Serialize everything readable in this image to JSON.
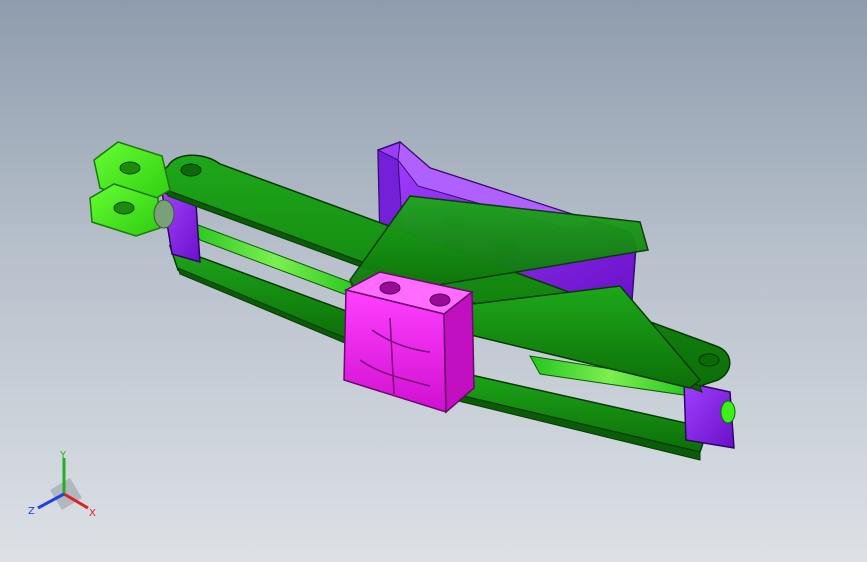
{
  "viewport": {
    "background_top": "#8f9cad",
    "background_bottom": "#dde1e6"
  },
  "model": {
    "parts": [
      {
        "name": "scissor-arms",
        "color": "#118a0c"
      },
      {
        "name": "top-saddle",
        "color": "#8a1cf0"
      },
      {
        "name": "center-block",
        "color": "#f018f0"
      },
      {
        "name": "clevis-end",
        "color": "#3ef01a"
      }
    ]
  },
  "triad": {
    "x_label": "X",
    "y_label": "Y",
    "z_label": "Z",
    "x_color": "#e02020",
    "y_color": "#20b020",
    "z_color": "#2040e0"
  }
}
